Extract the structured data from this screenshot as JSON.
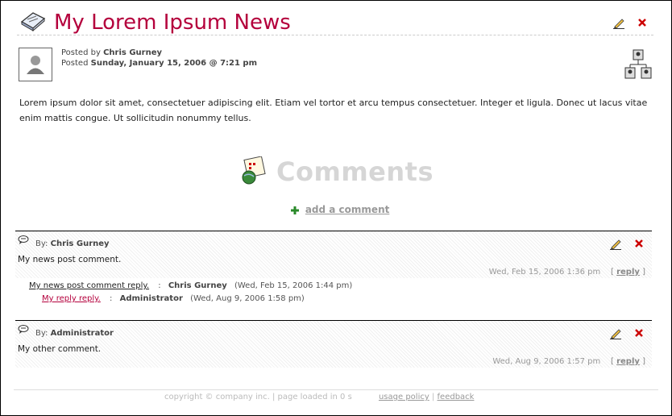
{
  "post": {
    "title": "My Lorem Ipsum News",
    "posted_by_label": "Posted by",
    "author": "Chris Gurney",
    "posted_label": "Posted",
    "date": "Sunday, January 15, 2006 @ 7:21 pm",
    "body": "Lorem ipsum dolor sit amet, consectetuer adipiscing elit. Etiam vel tortor et arcu tempus consectetuer. Integer et ligula. Donec ut lacus vitae enim mattis congue. Ut sollicitudin nonummy tellus."
  },
  "comments_section": {
    "heading": "Comments",
    "add_label": "add a comment"
  },
  "comments": [
    {
      "by_label": "By:",
      "author": "Chris Gurney",
      "text": "My news post comment.",
      "date": "Wed, Feb 15, 2006 1:36 pm",
      "reply_label": "reply"
    },
    {
      "by_label": "By:",
      "author": "Administrator",
      "text": "My other comment.",
      "date": "Wed, Aug 9, 2006 1:57 pm",
      "reply_label": "reply"
    }
  ],
  "replies": [
    {
      "text": "My news post comment reply.",
      "author": "Chris Gurney",
      "date": "(Wed, Feb 15, 2006 1:44 pm)"
    },
    {
      "text": "My reply reply.",
      "author": "Administrator",
      "date": "(Wed, Aug 9, 2006 1:58 pm)"
    }
  ],
  "footer": {
    "copyright": "copyright © company inc. | page loaded in 0 s",
    "usage": "usage policy",
    "feedback": "feedback"
  },
  "colors": {
    "title": "#b4003c",
    "delete": "#cc0000"
  },
  "icons": [
    "news-icon",
    "pencil-icon",
    "delete-icon",
    "avatar",
    "org-chart-icon",
    "comments-icon",
    "plus-icon",
    "speech-bubble-icon"
  ]
}
